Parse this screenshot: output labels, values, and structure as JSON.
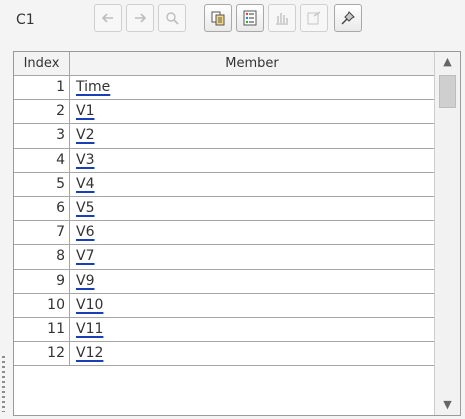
{
  "panel": {
    "title": "C1"
  },
  "toolbar": {
    "buttons": [
      {
        "icon": "back-arrow-icon",
        "enabled": false
      },
      {
        "icon": "forward-arrow-icon",
        "enabled": false
      },
      {
        "icon": "inspect-icon",
        "enabled": false
      },
      {
        "icon": "copy-icon",
        "enabled": true
      },
      {
        "icon": "list-view-icon",
        "enabled": true
      },
      {
        "icon": "chart-icon",
        "enabled": false
      },
      {
        "icon": "properties-icon",
        "enabled": false
      },
      {
        "icon": "pin-icon",
        "enabled": true
      }
    ]
  },
  "table": {
    "headers": {
      "index": "Index",
      "member": "Member"
    },
    "rows": [
      {
        "index": "1",
        "member": "Time"
      },
      {
        "index": "2",
        "member": "V1"
      },
      {
        "index": "3",
        "member": "V2"
      },
      {
        "index": "4",
        "member": "V3"
      },
      {
        "index": "5",
        "member": "V4"
      },
      {
        "index": "6",
        "member": "V5"
      },
      {
        "index": "7",
        "member": "V6"
      },
      {
        "index": "8",
        "member": "V7"
      },
      {
        "index": "9",
        "member": "V9"
      },
      {
        "index": "10",
        "member": "V10"
      },
      {
        "index": "11",
        "member": "V11"
      },
      {
        "index": "12",
        "member": "V12"
      }
    ]
  },
  "colors": {
    "link_underline": "#1a3fb5",
    "grid_lines": "#a6a6a6",
    "header_bg": "#f3f3f3"
  }
}
